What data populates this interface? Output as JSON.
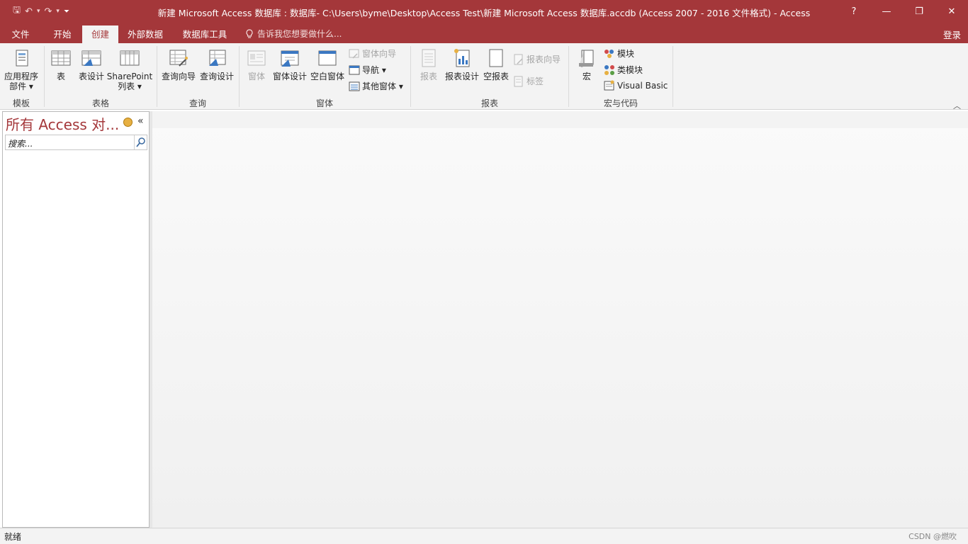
{
  "window": {
    "title": "新建 Microsoft Access 数据库 : 数据库- C:\\Users\\byme\\Desktop\\Access Test\\新建 Microsoft Access 数据库.accdb (Access 2007 - 2016 文件格式) - Access",
    "help": "?",
    "minimize": "—",
    "restore": "❐",
    "close": "✕"
  },
  "qat": {
    "save": "🖫",
    "undo": "↶",
    "undo_drop": "▾",
    "redo": "↷",
    "redo_drop": "▾",
    "customize": "⏷"
  },
  "tabs": [
    "文件",
    "开始",
    "创建",
    "外部数据",
    "数据库工具"
  ],
  "active_tab": "创建",
  "tellme": "告诉我您想要做什么...",
  "signin": "登录",
  "ribbon": {
    "groups": {
      "templates": "模板",
      "tables": "表格",
      "queries": "查询",
      "forms": "窗体",
      "reports": "报表",
      "macros": "宏与代码"
    },
    "app_parts": [
      "应用程序",
      "部件 ▾"
    ],
    "table": "表",
    "table_design": "表设计",
    "sharepoint": [
      "SharePoint",
      "列表 ▾"
    ],
    "query_wizard": "查询向导",
    "query_design": "查询设计",
    "form": "窗体",
    "form_design": "窗体设计",
    "blank_form": "空白窗体",
    "form_wizard": "窗体向导",
    "navigation": "导航 ▾",
    "more_forms": "其他窗体 ▾",
    "report": "报表",
    "report_design": "报表设计",
    "blank_report": "空报表",
    "report_wizard": "报表向导",
    "labels": "标签",
    "macro": "宏",
    "module": "模块",
    "class_module": "类模块",
    "visual_basic": "Visual Basic",
    "collapse": "︿"
  },
  "nav_pane": {
    "title": "所有 Access 对...",
    "collapse": "«",
    "search_placeholder": "搜索..."
  },
  "status": {
    "text": "就绪",
    "watermark": "CSDN @燃吹"
  },
  "colors": {
    "accent": "#a4373a",
    "ribbon_bg": "#f3f3f3"
  }
}
